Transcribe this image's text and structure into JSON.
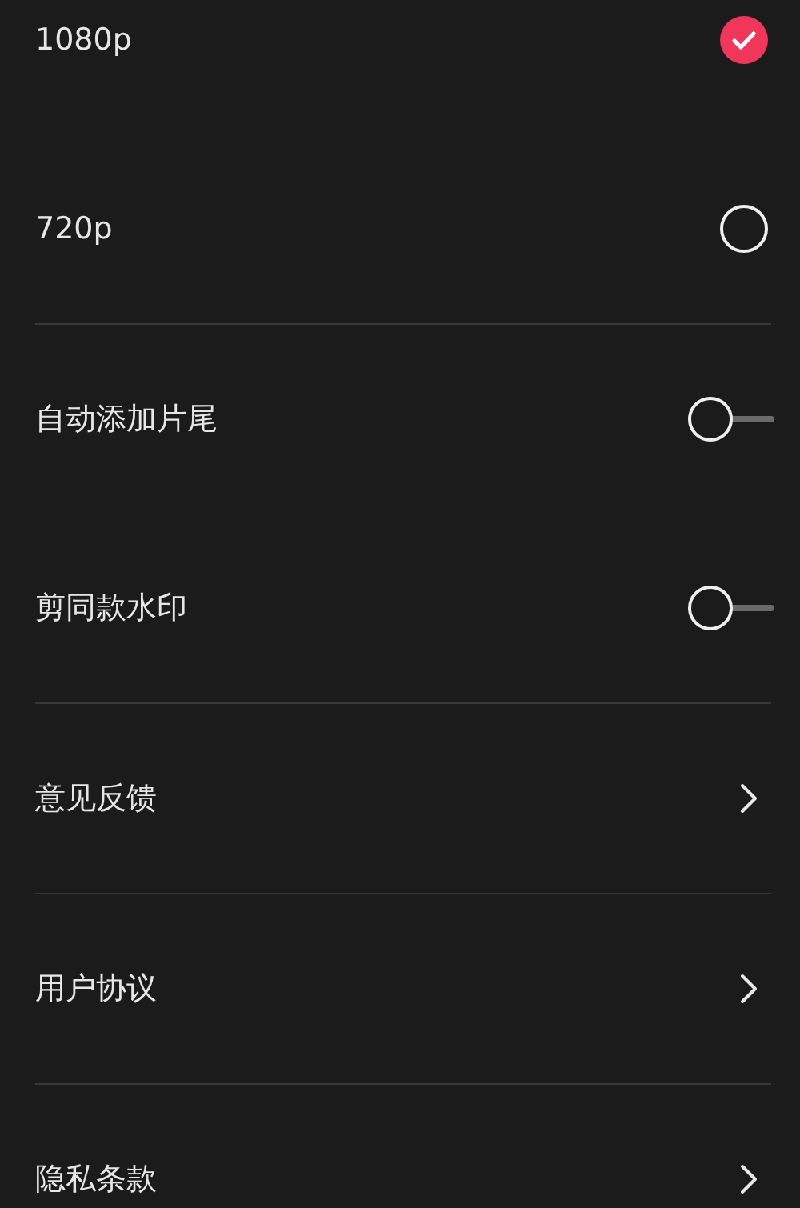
{
  "resolution_options": [
    {
      "label": "1080p",
      "selected": true
    },
    {
      "label": "720p",
      "selected": false
    }
  ],
  "toggles": [
    {
      "label": "自动添加片尾",
      "on": false
    },
    {
      "label": "剪同款水印",
      "on": false
    }
  ],
  "links": [
    {
      "label": "意见反馈"
    },
    {
      "label": "用户协议"
    },
    {
      "label": "隐私条款"
    }
  ]
}
